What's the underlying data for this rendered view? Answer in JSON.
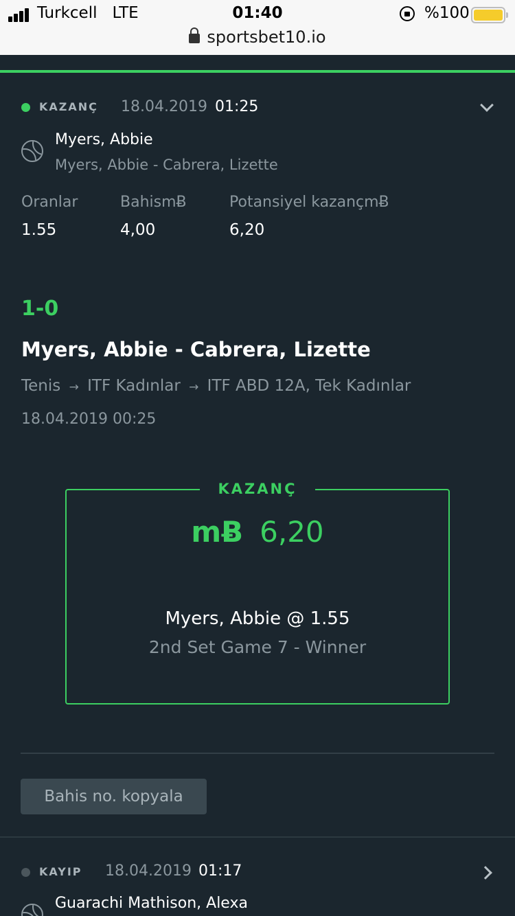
{
  "status_bar": {
    "carrier": "Turkcell",
    "network": "LTE",
    "time": "01:40",
    "battery": "%100",
    "battery_color": "#f5cc2b"
  },
  "browser": {
    "url": "sportsbet10.io"
  },
  "colors": {
    "accent": "#3ccf61",
    "background": "#1b262e",
    "muted": "#8b979e",
    "lost_dot": "#4b565c"
  },
  "bets": [
    {
      "status": "KAZANÇ",
      "date": "18.04.2019",
      "time": "01:25",
      "selection": "Myers, Abbie",
      "event": "Myers, Abbie - Cabrera, Lizette",
      "labels": {
        "odds": "Oranlar",
        "stake": "BahismɃ",
        "potential": "Potansiyel kazançmɃ"
      },
      "odds": "1.55",
      "stake": "4,00",
      "potential": "6,20",
      "icon": "tennis-ball-icon",
      "expand_icon": "chevron-down-icon",
      "details": {
        "score": "1-0",
        "title": "Myers, Abbie - Cabrera, Lizette",
        "breadcrumb": [
          "Tenis",
          "ITF Kadınlar",
          "ITF ABD 12A, Tek Kadınlar"
        ],
        "arrow": "→",
        "event_datetime": "18.04.2019 00:25",
        "result_label": "KAZANÇ",
        "currency": "mɃ",
        "win_amount": "6,20",
        "pick": "Myers, Abbie @ 1.55",
        "market": "2nd Set Game 7 - Winner",
        "copy_button": "Bahis no. kopyala"
      }
    },
    {
      "status": "KAYIP",
      "date": "18.04.2019",
      "time": "01:17",
      "selection": "Guarachi Mathison, Alexa",
      "icon": "tennis-ball-icon",
      "expand_icon": "chevron-right-icon"
    }
  ]
}
